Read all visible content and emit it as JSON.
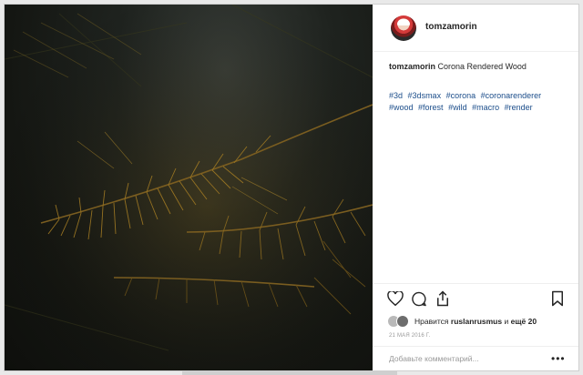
{
  "post": {
    "username": "tomzamorin",
    "caption_user": "tomzamorin",
    "caption_text": "Corona Rendered Wood",
    "hashtags": [
      "#3d",
      "#3dsmax",
      "#corona",
      "#coronarenderer",
      "#wood",
      "#forest",
      "#wild",
      "#macro",
      "#render"
    ],
    "likes_prefix": "Нравится",
    "likes_user": "ruslanrusmus",
    "likes_middle": "и",
    "likes_count_text": "ещё 20",
    "date": "21 МАЯ 2016 Г.",
    "comment_placeholder": "Добавьте комментарий...",
    "more_label": "•••"
  },
  "icons": {
    "like": "heart-icon",
    "comment": "comment-icon",
    "share": "share-icon",
    "save": "bookmark-icon"
  },
  "colors": {
    "hashtag": "#1b4d8a",
    "needle": "#8a6a1c"
  }
}
